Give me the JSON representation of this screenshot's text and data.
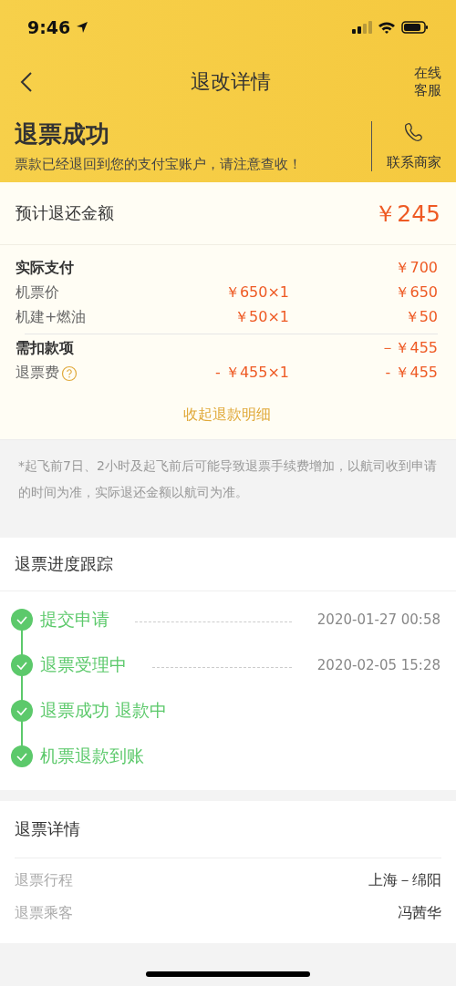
{
  "status_bar": {
    "time": "9:46"
  },
  "nav": {
    "title": "退改详情",
    "service": [
      "在线",
      "客服"
    ]
  },
  "result": {
    "title": "退票成功",
    "message": "票款已经退回到您的支付宝账户，请注意查收！",
    "contact": "联系商家"
  },
  "estimate": {
    "label": "预计退还金额",
    "amount": "￥245"
  },
  "fee_groups": [
    {
      "title": "实际支付",
      "total": "￥700",
      "items": [
        {
          "name": "机票价",
          "unit": "￥650×1",
          "amount": "￥650",
          "help": false
        },
        {
          "name": "机建+燃油",
          "unit": "￥50×1",
          "amount": "￥50",
          "help": false
        }
      ]
    },
    {
      "title": "需扣款项",
      "total": "－￥455",
      "items": [
        {
          "name": "退票费",
          "unit": "- ￥455×1",
          "amount": "- ￥455",
          "help": true
        }
      ]
    }
  ],
  "collapse_link": "收起退款明细",
  "note": "*起飞前7日、2小时及起飞前后可能导致退票手续费增加，以航司收到申请的时间为准，实际退还金额以航司为准。",
  "progress": {
    "title": "退票进度跟踪",
    "steps": [
      {
        "label": "提交申请",
        "time": "2020-01-27 00:58",
        "done": true
      },
      {
        "label": "退票受理中",
        "time": "2020-02-05 15:28",
        "done": true
      },
      {
        "label": "退票成功 退款中",
        "done": true
      },
      {
        "label": "机票退款到账",
        "done": true
      }
    ]
  },
  "details": {
    "title": "退票详情",
    "rows": [
      {
        "label": "退票行程",
        "value": "上海－绵阳"
      },
      {
        "label": "退票乘客",
        "value": "冯茜华"
      }
    ]
  }
}
